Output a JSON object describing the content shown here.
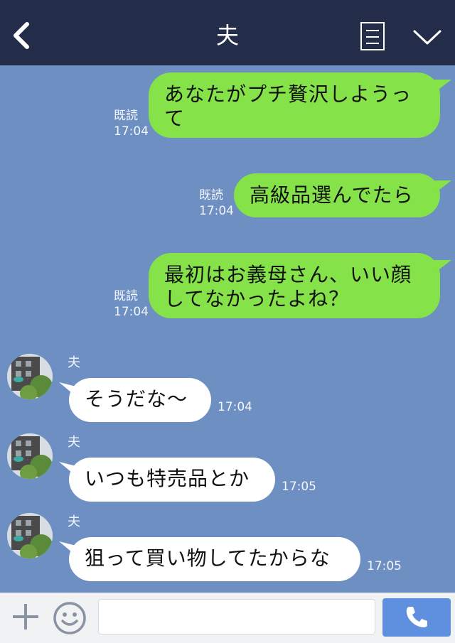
{
  "header": {
    "title": "夫"
  },
  "sent_messages": [
    {
      "line1": "あなたがプチ贅沢しようっ",
      "line2": "て",
      "read": "既読",
      "time": "17:04"
    },
    {
      "line1": "高級品選んでたら",
      "read": "既読",
      "time": "17:04"
    },
    {
      "line1": "最初はお義母さん、いい顔",
      "line2": "してなかったよね？",
      "read": "既読",
      "time": "17:04"
    }
  ],
  "received_messages": [
    {
      "sender": "夫",
      "text": "そうだな～",
      "time": "17:04"
    },
    {
      "sender": "夫",
      "text": "いつも特売品とか",
      "time": "17:05"
    },
    {
      "sender": "夫",
      "text": "狙って買い物してたからな",
      "time": "17:05"
    }
  ],
  "colors": {
    "header": "#232d49",
    "background": "#6d8fc2",
    "sent_bubble": "#85e249",
    "received_bubble": "#ffffff",
    "call_button": "#5f8fdf"
  },
  "icons": {
    "back": "chevron-left-icon",
    "menu": "notes-icon",
    "collapse": "chevron-down-icon",
    "add": "plus-icon",
    "emoji": "smiley-icon",
    "call": "phone-icon"
  }
}
